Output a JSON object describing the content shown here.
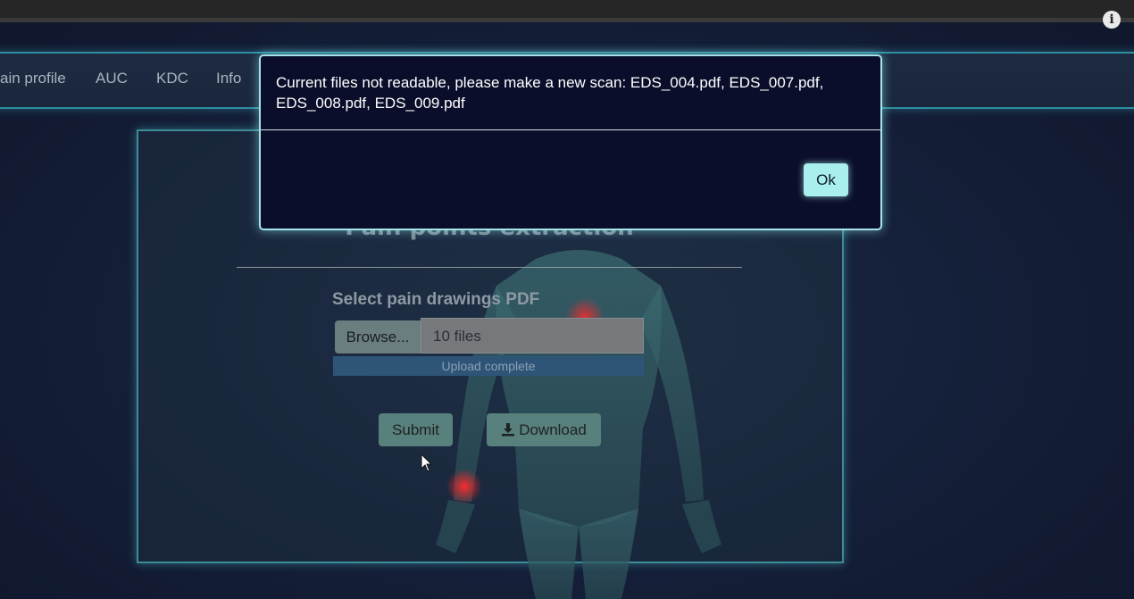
{
  "browser": {
    "info_icon": "info-icon"
  },
  "nav": {
    "items": [
      {
        "label": "ain profile"
      },
      {
        "label": "AUC"
      },
      {
        "label": "KDC"
      },
      {
        "label": "Info"
      }
    ]
  },
  "panel": {
    "title": "Pain points extraction",
    "select_label": "Select pain drawings PDF",
    "browse_label": "Browse...",
    "file_value": "10 files",
    "upload_status": "Upload complete",
    "upload_progress": 1.0,
    "submit_label": "Submit",
    "download_label": "Download",
    "download_icon": "download-icon"
  },
  "modal": {
    "message": "Current files not readable, please make a new scan: EDS_004.pdf, EDS_007.pdf, EDS_008.pdf, EDS_009.pdf",
    "ok_label": "Ok"
  },
  "colors": {
    "accent": "#2c8ea0",
    "modal_border": "#a6e4ea",
    "ok_button": "#a9efee",
    "modal_bg": "#0b0e2a",
    "button_dim": "#58807c",
    "pain_marker": "#d8202a"
  }
}
